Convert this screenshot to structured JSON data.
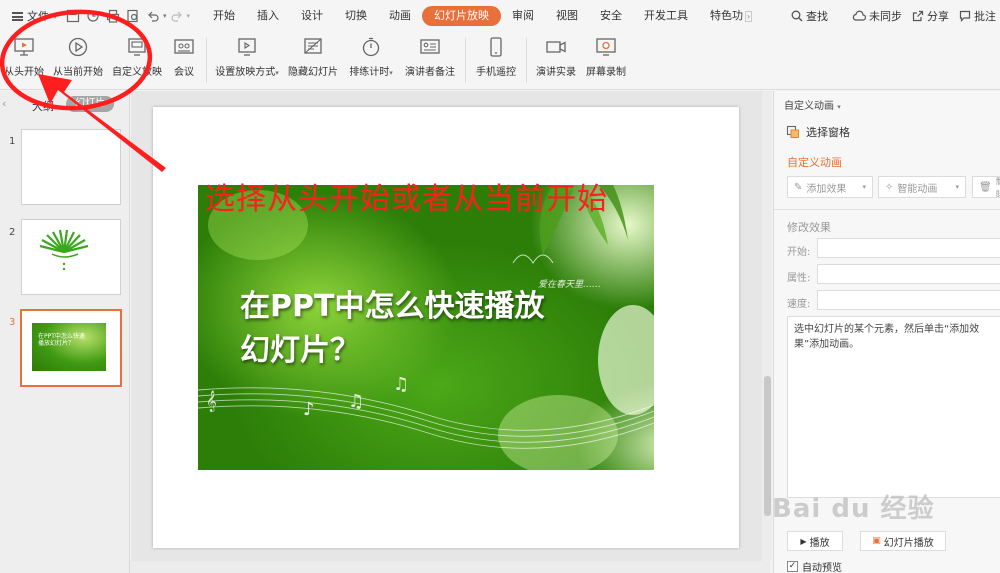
{
  "menubar": {
    "file_label": "文件",
    "tabs": [
      "开始",
      "插入",
      "设计",
      "切换",
      "动画",
      "幻灯片放映",
      "审阅",
      "视图",
      "安全",
      "开发工具",
      "特色功"
    ],
    "active_tab": "幻灯片放映",
    "right": {
      "search": "查找",
      "sync": "未同步",
      "share": "分享",
      "comment": "批注"
    }
  },
  "ribbon": {
    "buttons": {
      "from_start": "从头开始",
      "from_current": "从当前开始",
      "custom_show": "自定义放映",
      "meeting": "会议",
      "setup_show": "设置放映方式",
      "hide_slide": "隐藏幻灯片",
      "rehearse": "排练计时",
      "presenter_notes": "演讲者备注",
      "phone_remote": "手机遥控",
      "live_record": "演讲实录",
      "screen_record": "屏幕录制"
    }
  },
  "leftpanel": {
    "outline_tab": "大纲",
    "slides_tab": "幻灯片",
    "thumbs": [
      {
        "num": "1"
      },
      {
        "num": "2"
      },
      {
        "num": "3",
        "text": "在PPT中怎么快速播放幻灯片？"
      }
    ]
  },
  "slide": {
    "annotation": "选择从头开始或者从当前开始",
    "title_line1": "在PPT中怎么快速播放",
    "title_line2": "幻灯片？",
    "signature": "爱在春天里……"
  },
  "rightpanel": {
    "title": "自定义动画",
    "select_pane": "选择窗格",
    "section": "自定义动画",
    "add_effect": "添加效果",
    "smart_anim": "智能动画",
    "delete": "删除",
    "modify": "修改效果",
    "start_label": "开始:",
    "property_label": "属性:",
    "speed_label": "速度:",
    "hint": "选中幻灯片的某个元素，然后单击“添加效果”添加动画。",
    "play": "播放",
    "slideshow": "幻灯片播放",
    "autopreview": "自动预览"
  },
  "watermark": "Bai du 经验",
  "colors": {
    "accent": "#e8703a",
    "annotation_red": "#ff1e1e",
    "slide_green": "#3f9a12"
  }
}
